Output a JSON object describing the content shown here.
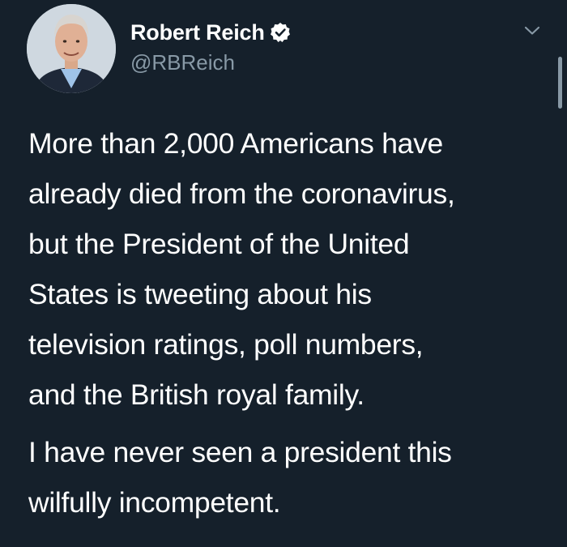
{
  "author": {
    "display_name": "Robert Reich",
    "handle": "@RBReich",
    "verified_icon": "verified-badge-icon"
  },
  "tweet": {
    "paragraph1_lines": [
      "More than 2,000 Americans have",
      "already died from the coronavirus,",
      "but the President of the United",
      "States is tweeting about his",
      "television ratings, poll numbers,",
      "and the British royal family."
    ],
    "paragraph2_lines": [
      "I have never seen a president this",
      "wilfully incompetent."
    ]
  },
  "icons": {
    "menu": "chevron-down-icon"
  },
  "colors": {
    "background": "#15202b",
    "text": "#ffffff",
    "secondary_text": "#8899a6"
  }
}
